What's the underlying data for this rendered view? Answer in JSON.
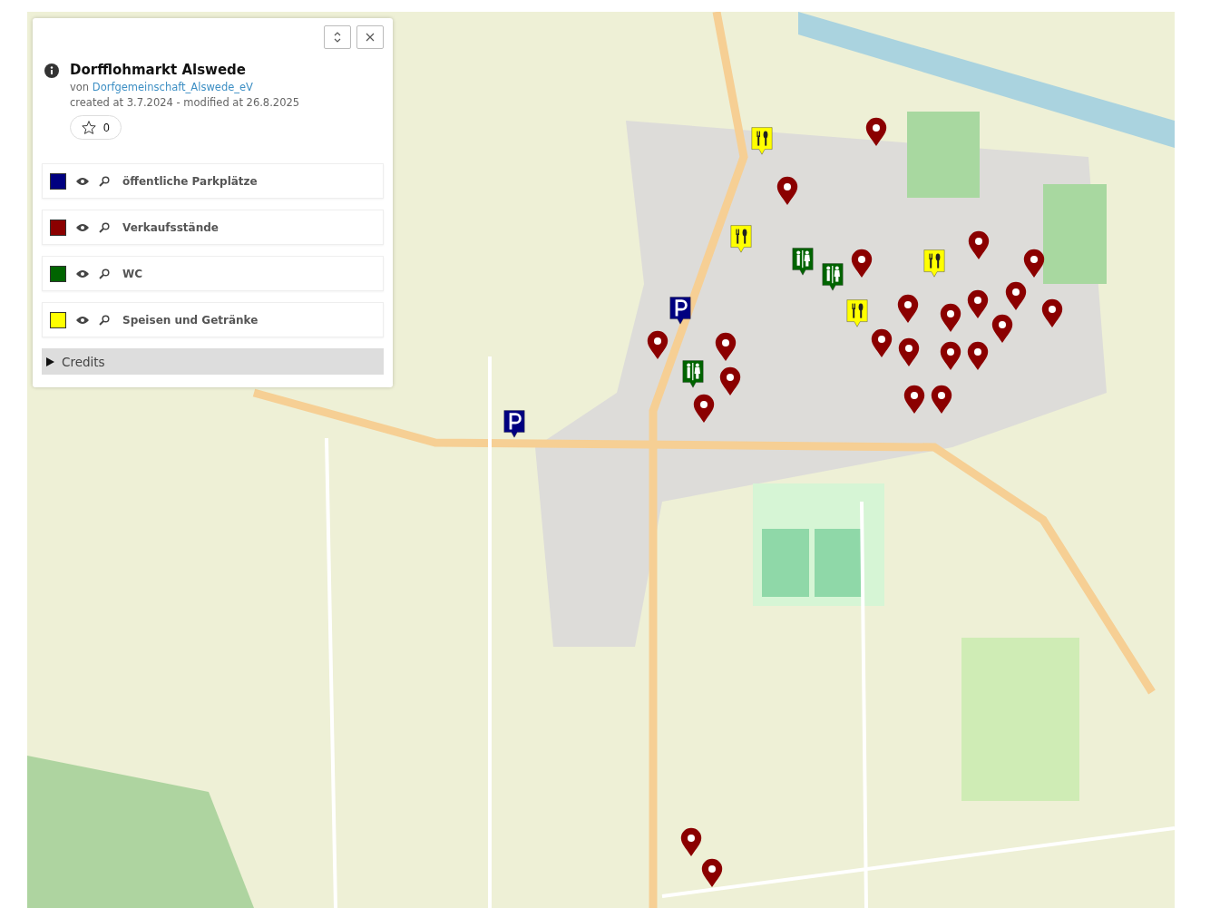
{
  "panel": {
    "title": "Dorfflohmarkt Alswede",
    "author_prefix": "von",
    "author": "Dorfgemeinschaft_Alswede_eV",
    "dates": "created at 3.7.2024 - modified at 26.8.2025",
    "stars_count": "0"
  },
  "layers": [
    {
      "label": "öffentliche Parkplätze",
      "color": "#000080",
      "visible": true
    },
    {
      "label": "Verkaufsstände",
      "color": "#8b0000",
      "visible": true
    },
    {
      "label": "WC",
      "color": "#006400",
      "visible": true
    },
    {
      "label": "Speisen und Getränke",
      "color": "#ffff00",
      "visible": true
    }
  ],
  "credits": {
    "label": "Credits",
    "expanded": false
  }
}
